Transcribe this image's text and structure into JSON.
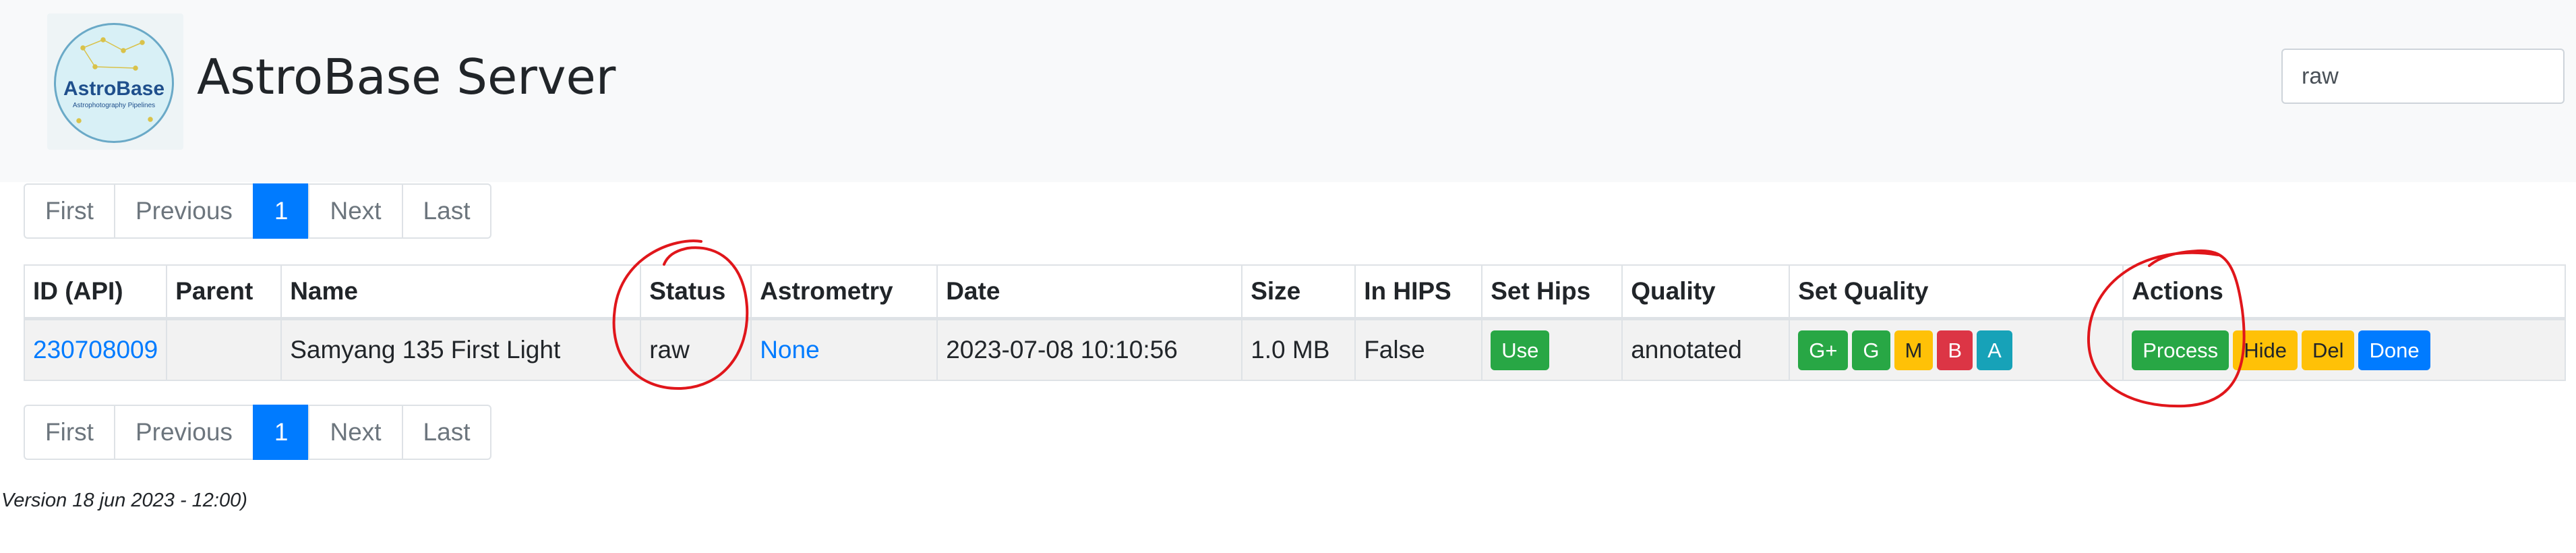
{
  "header": {
    "logo_text": "AstroBase",
    "logo_subtext": "Astrophotography Pipelines",
    "brand": "AstroBase Server",
    "search_value": "raw"
  },
  "pagination": {
    "first": "First",
    "previous": "Previous",
    "current": "1",
    "next": "Next",
    "last": "Last"
  },
  "table": {
    "headers": [
      "ID (API)",
      "Parent",
      "Name",
      "Status",
      "Astrometry",
      "Date",
      "Size",
      "In HIPS",
      "Set Hips",
      "Quality",
      "Set Quality",
      "Actions"
    ],
    "row": {
      "id": "230708009",
      "parent": "",
      "name": "Samyang 135 First Light",
      "status": "raw",
      "astrometry": "None",
      "date": "2023-07-08 10:10:56",
      "size": "1.0 MB",
      "in_hips": "False",
      "set_hips_button": "Use",
      "quality": "annotated",
      "quality_buttons": [
        "G+",
        "G",
        "M",
        "B",
        "A"
      ],
      "action_buttons": [
        "Process",
        "Hide",
        "Del",
        "Done"
      ]
    }
  },
  "footer": {
    "version": "Version 18 jun 2023 - 12:00)"
  },
  "colors": {
    "primary": "#007bff",
    "success": "#28a745",
    "warning": "#ffc107",
    "danger": "#dc3545",
    "info": "#17a2b8",
    "annotation": "#e0161b"
  },
  "annotations": [
    "red-circle-status",
    "red-circle-actions"
  ]
}
